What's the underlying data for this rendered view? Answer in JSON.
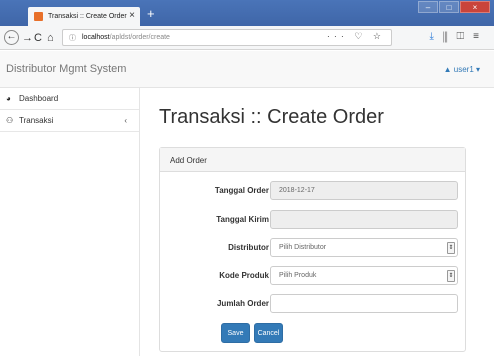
{
  "browser": {
    "tab_title": "Transaksi :: Create Order",
    "tab_close": "×",
    "new_tab": "+",
    "url_info": "ⓘ",
    "url_host": "localhost",
    "url_path": "/apldst/order/create",
    "url_actions": "··· ♡ ☆",
    "window_min": "–",
    "window_max": "□",
    "window_close": "×"
  },
  "app": {
    "brand": "Distributor Mgmt System",
    "user_menu": "▲ user1 ▾"
  },
  "sidebar": {
    "items": [
      {
        "label": "Dashboard",
        "icon": "dashboard-icon",
        "glyph": "◕"
      },
      {
        "label": "Transaksi",
        "icon": "users-icon",
        "glyph": "⚇",
        "chevron": "‹"
      }
    ]
  },
  "page": {
    "title": "Transaksi :: Create Order"
  },
  "panel": {
    "heading": "Add Order",
    "fields": [
      {
        "label": "Tanggal Order",
        "value": "2018-12-17"
      },
      {
        "label": "Tanggal Kirim",
        "value": ""
      },
      {
        "label": "Distributor",
        "value": "Pilih Distributor"
      },
      {
        "label": "Kode Produk",
        "value": "Pilih Produk"
      },
      {
        "label": "Jumlah Order",
        "value": ""
      }
    ],
    "save_label": "Save",
    "cancel_label": "Cancel"
  },
  "colors": {
    "primary": "#337ab7",
    "browser_titlebar": "#4a74b8"
  }
}
